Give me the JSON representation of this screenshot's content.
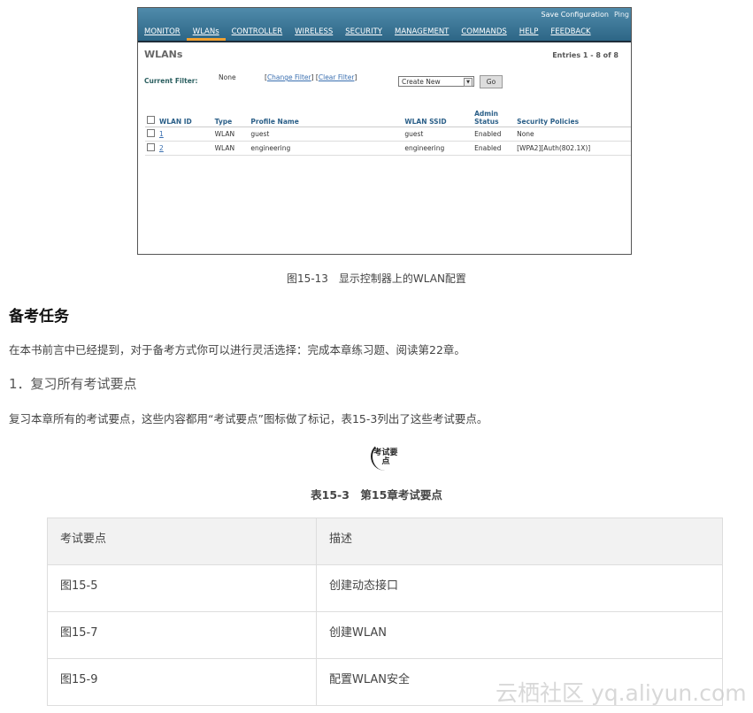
{
  "screenshot": {
    "top_links": [
      "Save Configuration",
      "Ping"
    ],
    "nav": [
      "MONITOR",
      "WLANs",
      "CONTROLLER",
      "WIRELESS",
      "SECURITY",
      "MANAGEMENT",
      "COMMANDS",
      "HELP",
      "FEEDBACK"
    ],
    "title": "WLANs",
    "entries": "Entries 1 - 8 of 8",
    "filter_label": "Current Filter:",
    "filter_value": "None",
    "change_filter": "Change Filter",
    "clear_filter": "Clear Filter",
    "select_value": "Create New",
    "go": "Go",
    "columns": [
      "WLAN ID",
      "Type",
      "Profile Name",
      "WLAN SSID",
      "Admin Status",
      "Security Policies"
    ],
    "rows": [
      {
        "id": "1",
        "type": "WLAN",
        "profile": "guest",
        "ssid": "guest",
        "status": "Enabled",
        "policy": "None"
      },
      {
        "id": "2",
        "type": "WLAN",
        "profile": "engineering",
        "ssid": "engineering",
        "status": "Enabled",
        "policy": "[WPA2][Auth(802.1X)]"
      }
    ]
  },
  "figure_caption": "图15-13　显示控制器上的WLAN配置",
  "section_title": "备考任务",
  "para1": "在本书前言中已经提到，对于备考方式你可以进行灵活选择：完成本章练习题、阅读第22章。",
  "sub_title": "1．复习所有考试要点",
  "para2": "复习本章所有的考试要点，这些内容都用“考试要点”图标做了标记，表15-3列出了这些考试要点。",
  "badge": "考试要点",
  "table_caption": "表15-3　第15章考试要点",
  "table": {
    "headers": [
      "考试要点",
      "描述"
    ],
    "rows": [
      [
        "图15-5",
        "创建动态接口"
      ],
      [
        "图15-7",
        "创建WLAN"
      ],
      [
        "图15-9",
        "配置WLAN安全"
      ]
    ]
  },
  "watermark": "云栖社区 yq.aliyun.com"
}
